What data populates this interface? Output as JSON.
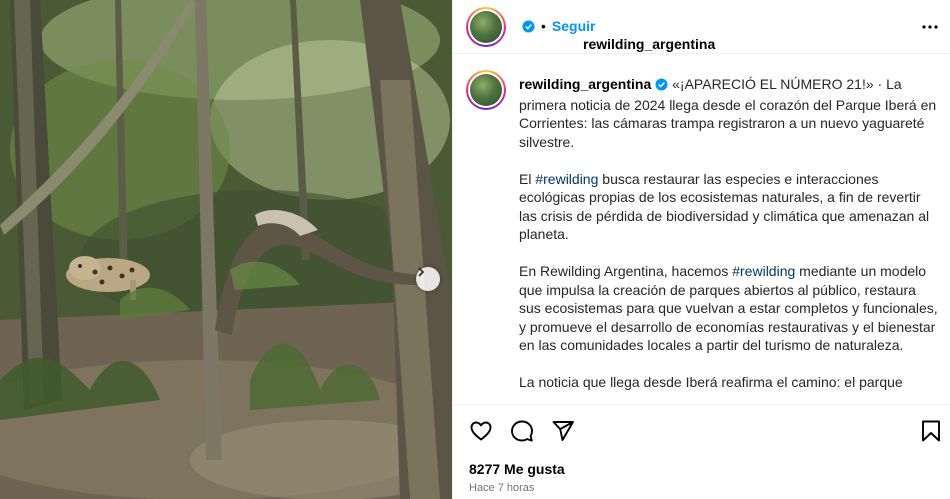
{
  "photo": {
    "description_icon": "image",
    "next_icon": "chevron-right-icon"
  },
  "header": {
    "username": "rewilding_argentina",
    "separator": "•",
    "follow_label": "Seguir",
    "more_icon": "more-horizontal-icon"
  },
  "caption": {
    "username": "rewilding_argentina",
    "para1": "«¡APARECIÓ EL NÚMERO 21!» · La primera noticia de 2024 llega desde el corazón del Parque Iberá en Corrientes: las cámaras trampa registraron a un nuevo yaguareté silvestre.",
    "para2_pre": "El ",
    "para2_tag": "#rewilding",
    "para2_post": " busca restaurar las especies e interacciones ecológicas propias de los ecosistemas naturales, a fin de revertir las crisis de pérdida de biodiversidad y climática que amenazan al planeta.",
    "para3_pre": "En Rewilding Argentina, hacemos ",
    "para3_tag": "#rewilding",
    "para3_post": " mediante un modelo que impulsa la creación de parques abiertos al público, restaura sus ecosistemas para que vuelvan a estar completos y funcionales, y promueve el desarrollo de economías restaurativas y el bienestar en las comunidades locales a partir del turismo de naturaleza.",
    "para4": "La noticia que llega desde Iberá reafirma el camino: el parque"
  },
  "actions": {
    "icons": [
      "heart-icon",
      "comment-icon",
      "share-icon",
      "bookmark-icon"
    ]
  },
  "stats": {
    "likes": "8277 Me gusta",
    "time": "Hace 7 horas"
  },
  "colors": {
    "link": "#0095f6",
    "hashtag": "#00376b",
    "verified": "#0095f6",
    "muted": "#737373"
  }
}
